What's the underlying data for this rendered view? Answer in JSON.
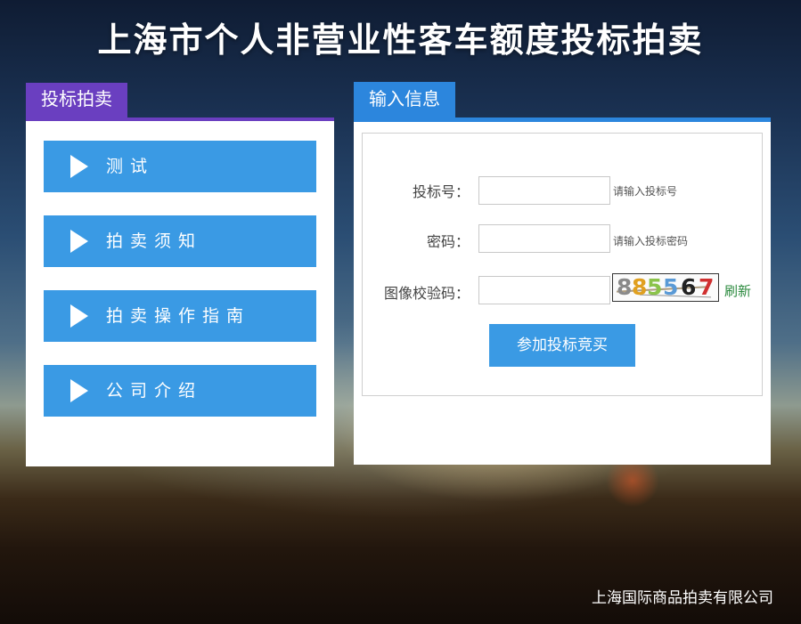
{
  "page": {
    "title": "上海市个人非营业性客车额度投标拍卖",
    "footer": "上海国际商品拍卖有限公司"
  },
  "left_panel": {
    "tab_label": "投标拍卖",
    "menu": [
      {
        "label": "测试"
      },
      {
        "label": "拍卖须知"
      },
      {
        "label": "拍卖操作指南"
      },
      {
        "label": "公司介绍"
      }
    ]
  },
  "right_panel": {
    "tab_label": "输入信息",
    "fields": {
      "bid_number": {
        "label": "投标号：",
        "value": "",
        "hint": "请输入投标号"
      },
      "password": {
        "label": "密码：",
        "value": "",
        "hint": "请输入投标密码"
      },
      "captcha": {
        "label": "图像校验码：",
        "value": ""
      }
    },
    "captcha_image": {
      "digits": [
        "8",
        "8",
        "5",
        "5",
        "6",
        "7"
      ],
      "colors": [
        "#8a8a8a",
        "#e0a020",
        "#8bc34a",
        "#5a9ad6",
        "#222222",
        "#d03030"
      ]
    },
    "refresh_label": "刷新",
    "submit_label": "参加投标竞买"
  },
  "colors": {
    "left_accent": "#6a3fc0",
    "right_accent": "#2c86dd",
    "button_blue": "#3a9ae4",
    "refresh_green": "#2b8a3e"
  }
}
